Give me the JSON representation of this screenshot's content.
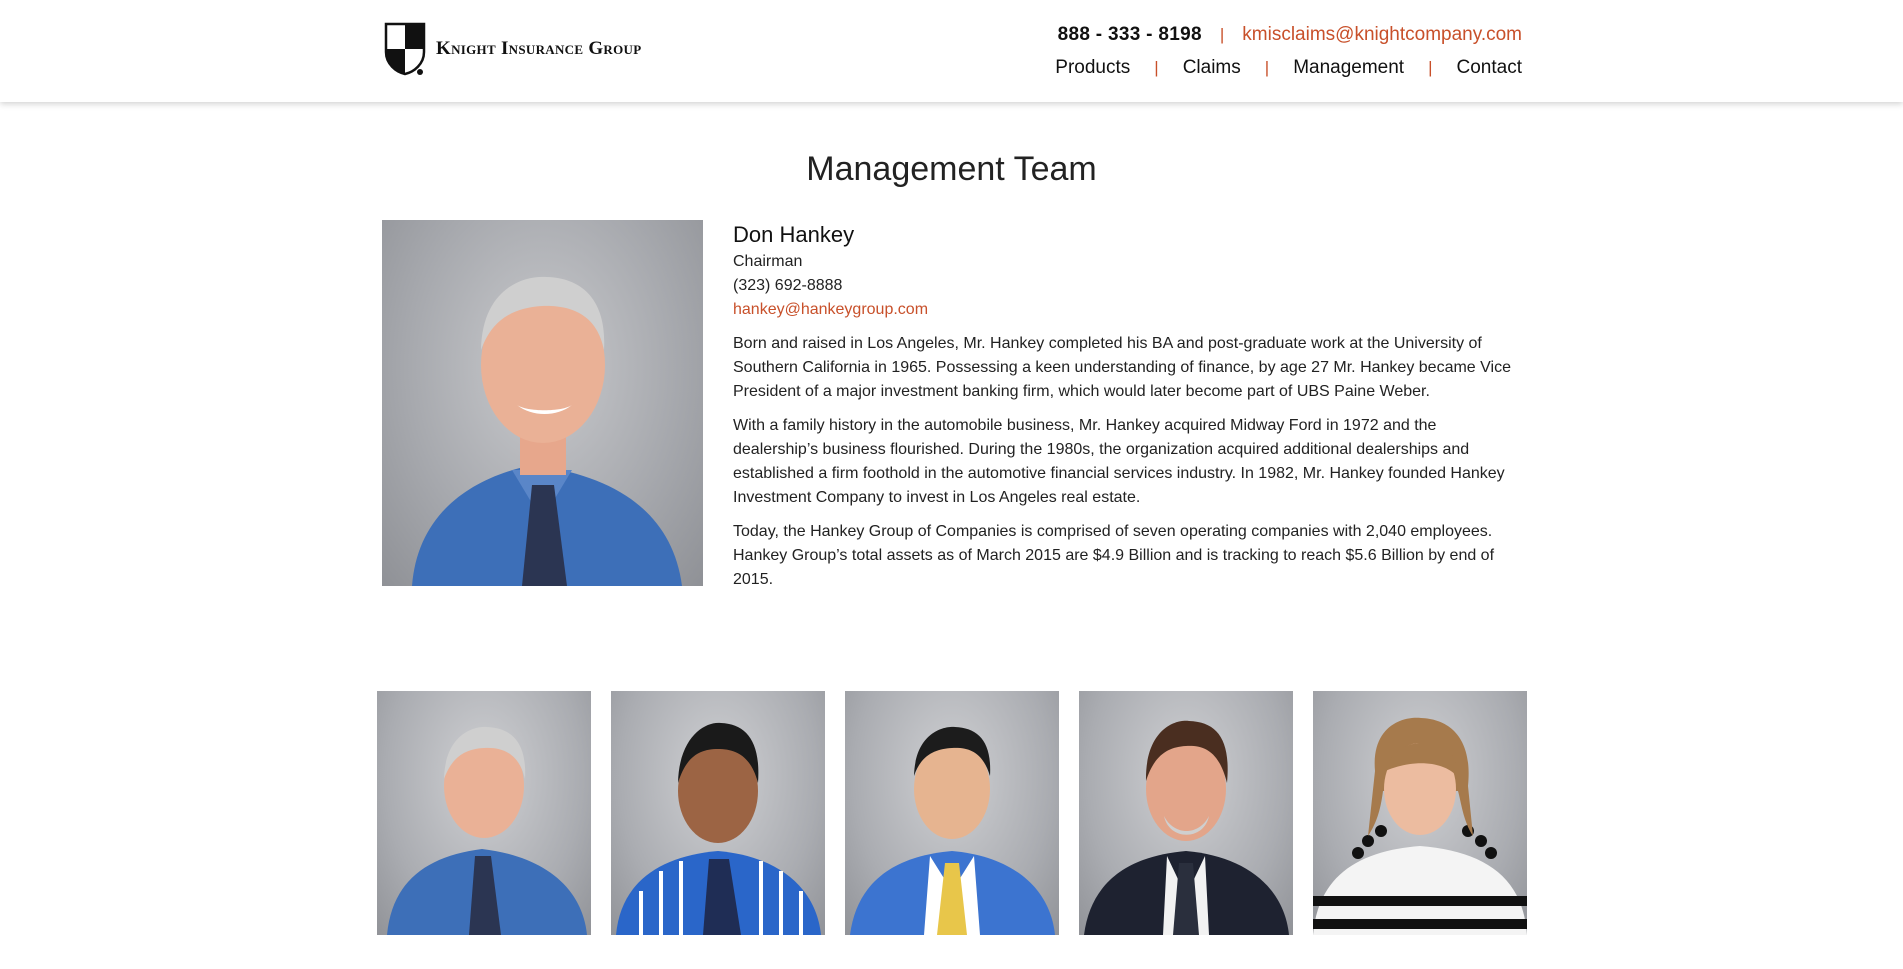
{
  "header": {
    "logo_text": "Knight Insurance Group",
    "phone": "888 - 333 - 8198",
    "email": "kmisclaims@knightcompany.com",
    "nav": [
      {
        "label": "Products"
      },
      {
        "label": "Claims"
      },
      {
        "label": "Management"
      },
      {
        "label": "Contact"
      }
    ]
  },
  "page": {
    "title": "Management Team"
  },
  "featured": {
    "name": "Don Hankey",
    "role": "Chairman",
    "phone": "(323) 692-8888",
    "email": "hankey@hankeygroup.com",
    "paragraphs": [
      "Born and raised in Los Angeles, Mr. Hankey completed his BA and post-graduate work at the University of Southern California in 1965. Possessing a keen understanding of finance, by age 27 Mr. Hankey became Vice President of a major investment banking firm, which would later become part of UBS Paine Weber.",
      "With a family history in the automobile business, Mr. Hankey acquired Midway Ford in 1972 and the dealership’s business flourished. During the 1980s, the organization acquired additional dealerships and established a firm foothold in the automotive financial services industry. In 1982, Mr. Hankey founded Hankey Investment Company to invest in Los Angeles real estate.",
      "Today, the Hankey Group of Companies is comprised of seven operating companies with 2,040 employees. Hankey Group’s total assets as of March 2015 are $4.9 Billion and is tracking to reach $5.6 Billion by end of 2015."
    ]
  },
  "colors": {
    "accent": "#c8502a",
    "text": "#222222"
  }
}
